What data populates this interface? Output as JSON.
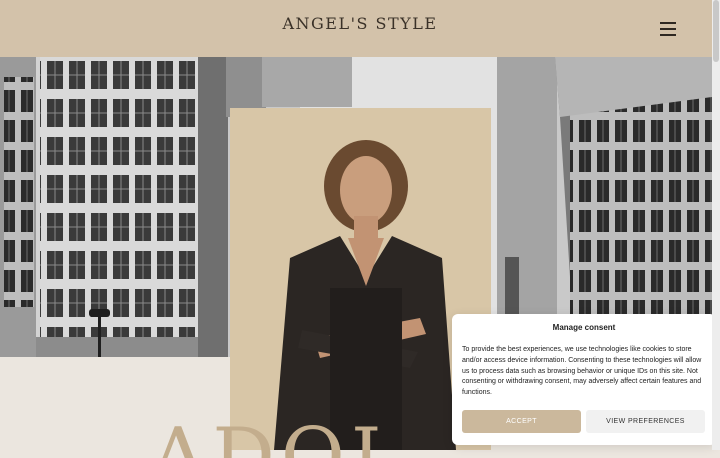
{
  "header": {
    "logo_text": "ANGEL'S STYLE",
    "menu_icon": "hamburger-menu-icon"
  },
  "hero": {
    "big_title_partial": "ADOL"
  },
  "consent": {
    "title": "Manage consent",
    "body": "To provide the best experiences, we use technologies like cookies to store and/or access device information. Consenting to these technologies will allow us to process data such as browsing behavior or unique IDs on this site. Not consenting or withdrawing consent, may adversely affect certain features and functions.",
    "accept_label": "ACCEPT",
    "preferences_label": "VIEW PREFERENCES"
  },
  "colors": {
    "header_bg": "#d3c2aa",
    "accent": "#cbb89c",
    "page_bg": "#ece6df"
  }
}
